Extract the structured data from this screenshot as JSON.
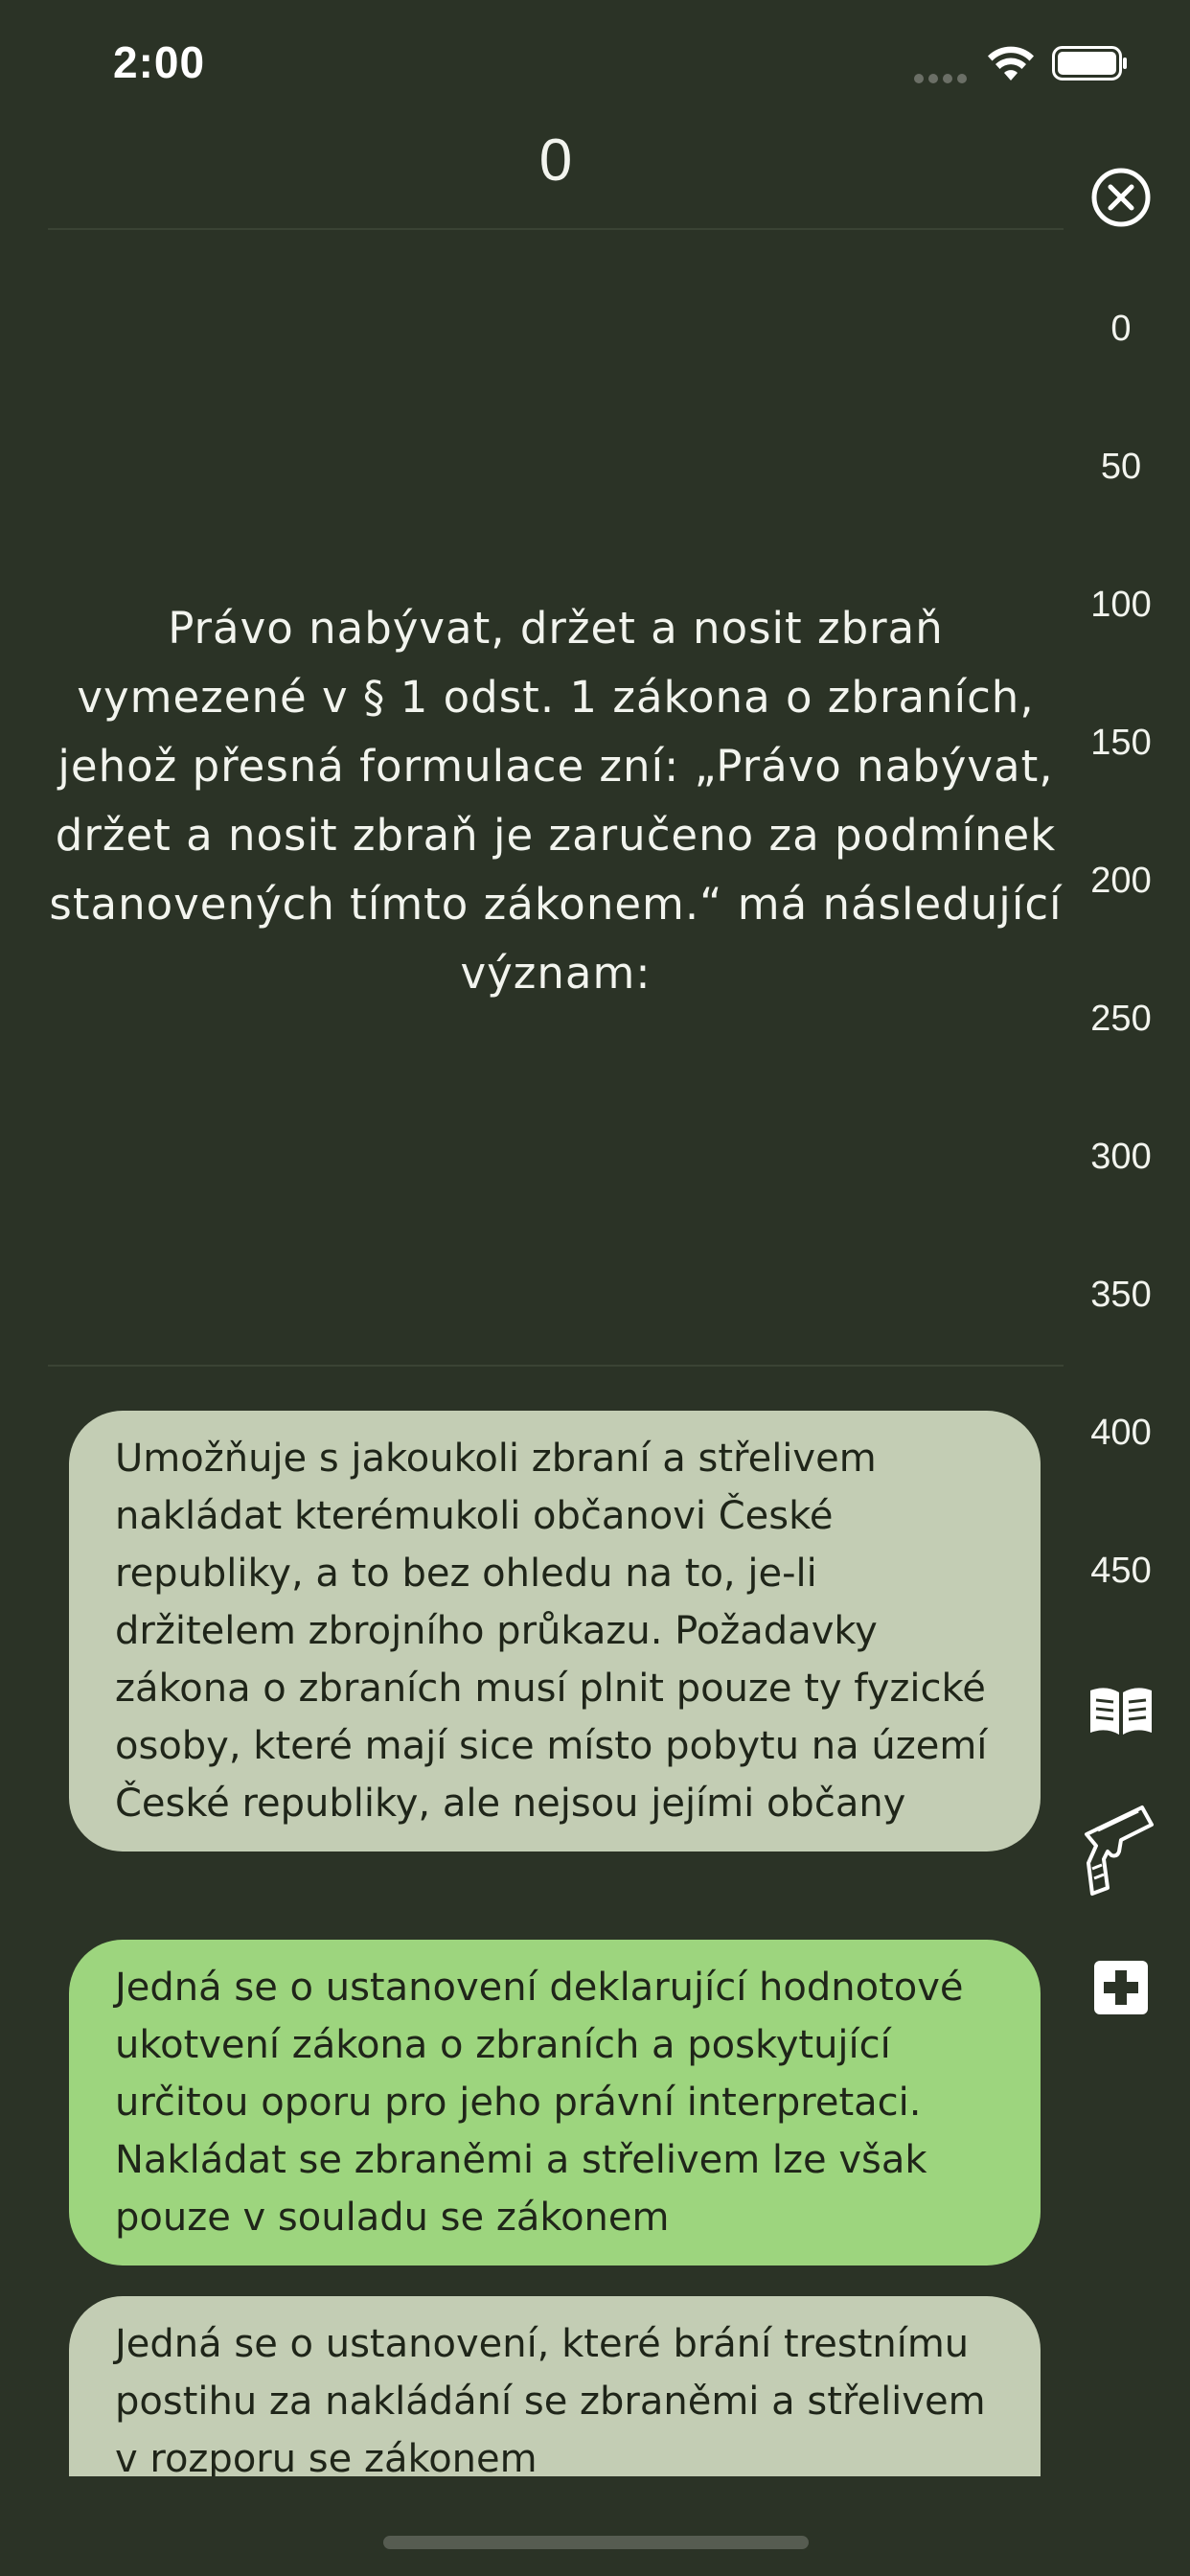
{
  "status_bar": {
    "time": "2:00"
  },
  "header": {
    "score": "0"
  },
  "question": {
    "text": "Právo nabývat, držet a nosit zbraň vymezené v § 1 odst. 1 zákona o zbraních, jehož přesná formulace zní: „Právo nabývat, držet a nosit zbraň je zaručeno za podmínek stanovených tímto zákonem.“ má následující význam:"
  },
  "timeline": {
    "ticks": [
      "0",
      "50",
      "100",
      "150",
      "200",
      "250",
      "300",
      "350",
      "400",
      "450"
    ]
  },
  "answers": [
    {
      "text": "Umožňuje s jakoukoli zbraní a střelivem nakládat kterémukoli občanovi České republiky, a to bez ohledu na to, je-li držitelem zbrojního průkazu. Požadavky zákona o zbraních musí plnit pouze ty fyzické osoby, které mají sice místo pobytu na území České republiky, ale nejsou jejími občany",
      "state": "neutral"
    },
    {
      "text": "Jedná se o ustanovení deklarující hodnotové ukotvení zákona o zbraních a poskytující určitou oporu pro jeho právní interpretaci. Nakládat se zbraněmi a střelivem lze však pouze v souladu se zákonem",
      "state": "correct"
    },
    {
      "text": "Jedná se o ustanovení, které brání trestnímu postihu za nakládání se zbraněmi a střelivem v rozporu se zákonem",
      "state": "neutral"
    }
  ],
  "icons": {
    "close": "close-circle-icon",
    "book": "open-book-icon",
    "gun": "pistol-icon",
    "plus": "plus-box-icon",
    "wifi": "wifi-icon",
    "battery": "battery-icon"
  },
  "colors": {
    "background": "#2b3326",
    "answer_neutral": "#c3cdb4",
    "answer_correct": "#9dd57e"
  }
}
